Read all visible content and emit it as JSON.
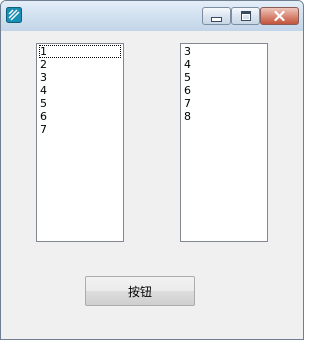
{
  "window": {
    "title": ""
  },
  "titlebar": {
    "app_icon": "app-icon",
    "controls": [
      "minimize-icon",
      "maximize-icon",
      "close-icon"
    ]
  },
  "left_list": {
    "items": [
      "1",
      "2",
      "3",
      "4",
      "5",
      "6",
      "7"
    ],
    "focused_index": 0
  },
  "right_list": {
    "items": [
      "3",
      "4",
      "5",
      "6",
      "7",
      "8"
    ]
  },
  "button": {
    "label": "按钮"
  },
  "colors": {
    "window_bg": "#f0f0f0",
    "list_border": "#828790",
    "close_button": "#c2543c"
  }
}
